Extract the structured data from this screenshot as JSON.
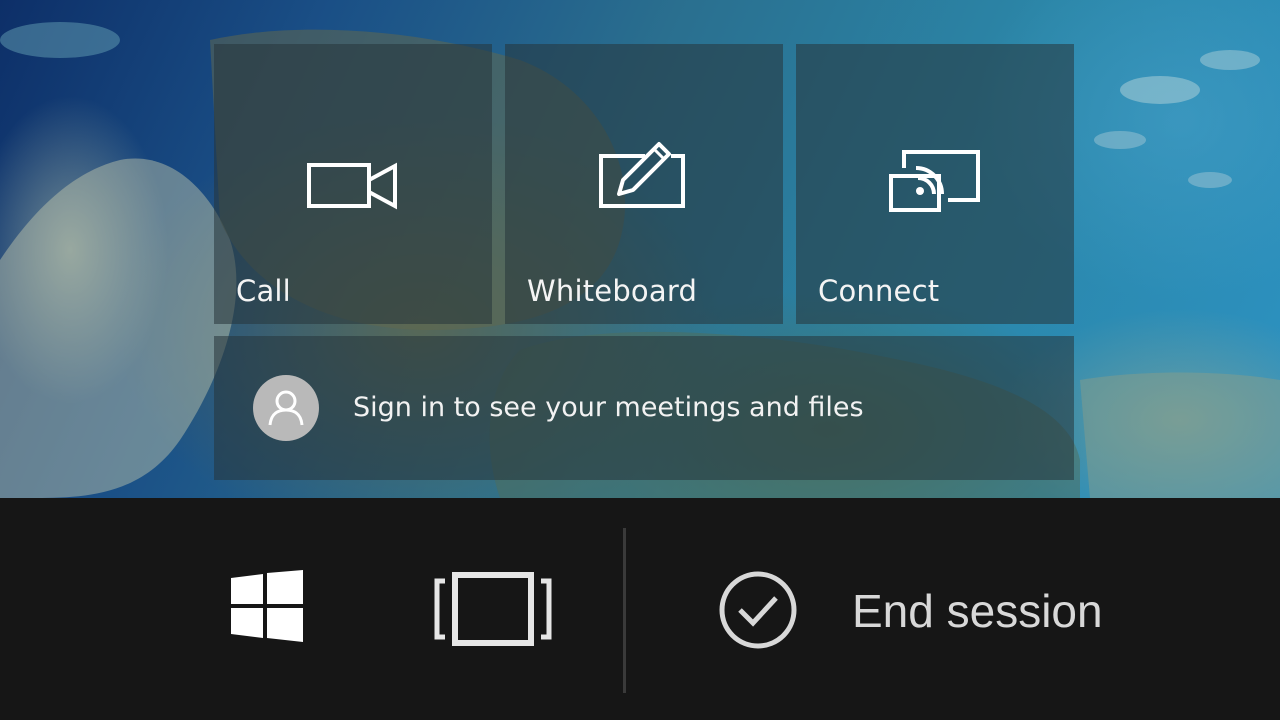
{
  "tiles": {
    "call": {
      "label": "Call",
      "icon": "video-camera-icon"
    },
    "whiteboard": {
      "label": "Whiteboard",
      "icon": "pen-board-icon"
    },
    "connect": {
      "label": "Connect",
      "icon": "cast-screen-icon"
    }
  },
  "signin": {
    "text": "Sign in to see your meetings and files",
    "icon": "person-avatar-icon"
  },
  "taskbar": {
    "start_icon": "windows-logo-icon",
    "screen_icon": "screen-frame-icon",
    "end_icon": "check-circle-icon",
    "end_label": "End session"
  },
  "colors": {
    "tile_overlay": "#26343a",
    "taskbar_bg": "#161616",
    "text": "#ffffff"
  }
}
